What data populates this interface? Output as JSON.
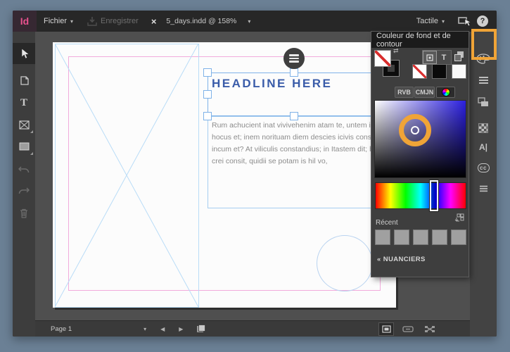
{
  "app": {
    "logo": "Id",
    "topbar": {
      "file_menu": "Fichier",
      "save": "Enregistrer",
      "document_tab": "5_days.indd @ 158%",
      "workspace": "Tactile",
      "help": "?"
    }
  },
  "icons": {
    "caret_down": "▾",
    "close": "×",
    "prev": "◀",
    "next": "▶",
    "swap": "⇄"
  },
  "tools": {
    "type_label": "T"
  },
  "canvas": {
    "headline": "HEADLINE HERE",
    "body_lines": [
      "Rum achucient inat vivivehenim atam te, untem is",
      "hocus et; inem norituam diem descies icivis consu",
      "incum et? At viliculis constandius; in Itastem dit; h",
      "crei consit, quidii se potam is hil vo,"
    ]
  },
  "color_panel": {
    "title": "Couleur de fond et de contour",
    "text_toggle": "T",
    "mode_rvb": "RVB",
    "mode_cmjn": "CMJN",
    "recent_label": "Récent",
    "swatches_link": "« NUANCIERS",
    "recent_swatches": [
      "#a0a0a0",
      "#a0a0a0",
      "#a0a0a0",
      "#a0a0a0",
      "#a0a0a0"
    ]
  },
  "sidebar": {
    "character_styles": "A|",
    "creative_cloud": "cc"
  },
  "statusbar": {
    "page_label": "Page 1"
  },
  "colors": {
    "annotation_orange": "#f0a437",
    "headline_blue": "#3a5ca9",
    "selection_blue": "#7fb2e8",
    "guide_pink": "#f2abdc",
    "guide_blue": "#b9dcf7",
    "logo_pink": "#e8518e",
    "picker_hue_blue": "#2b1fe0"
  }
}
